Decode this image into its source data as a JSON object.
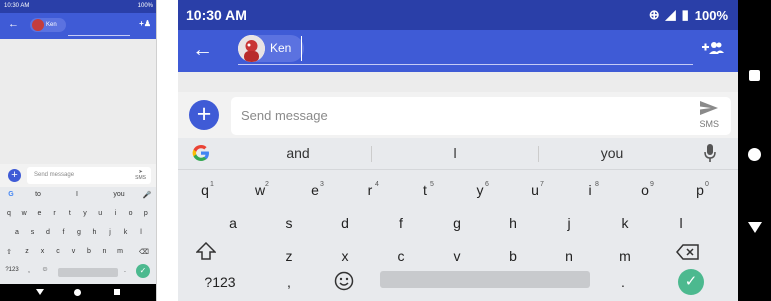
{
  "status": {
    "time": "10:30 AM",
    "battery": "100%",
    "small_time": "10:30 AM",
    "small_battery": "100%"
  },
  "appbar": {
    "contact_name": "Ken",
    "back_glyph": "←",
    "add_people_glyph": "+👥"
  },
  "compose": {
    "placeholder": "Send message",
    "send_label": "SMS",
    "plus_glyph": "+"
  },
  "keyboard": {
    "suggestions": [
      "and",
      "l",
      "you"
    ],
    "small_suggestions": [
      "to",
      "I",
      "you"
    ],
    "row1": [
      {
        "k": "q",
        "n": "1"
      },
      {
        "k": "w",
        "n": "2"
      },
      {
        "k": "e",
        "n": "3"
      },
      {
        "k": "r",
        "n": "4"
      },
      {
        "k": "t",
        "n": "5"
      },
      {
        "k": "y",
        "n": "6"
      },
      {
        "k": "u",
        "n": "7"
      },
      {
        "k": "i",
        "n": "8"
      },
      {
        "k": "o",
        "n": "9"
      },
      {
        "k": "p",
        "n": "0"
      }
    ],
    "row2": [
      "a",
      "s",
      "d",
      "f",
      "g",
      "h",
      "j",
      "k",
      "l"
    ],
    "row3": [
      "z",
      "x",
      "c",
      "v",
      "b",
      "n",
      "m"
    ],
    "symbols_label": "?123",
    "comma": ",",
    "period": "."
  },
  "colors": {
    "status_bar": "#2a3fa8",
    "app_bar": "#3f5bd6",
    "accent": "#3f5bd6",
    "enter": "#4cb98f"
  },
  "icons": [
    "back-arrow-icon",
    "add-people-icon",
    "plus-icon",
    "send-icon",
    "google-icon",
    "mic-icon",
    "shift-icon",
    "backspace-icon",
    "emoji-icon",
    "checkmark-icon",
    "wifi-icon",
    "signal-icon",
    "battery-icon",
    "nav-recents-icon",
    "nav-home-icon",
    "nav-back-icon"
  ]
}
